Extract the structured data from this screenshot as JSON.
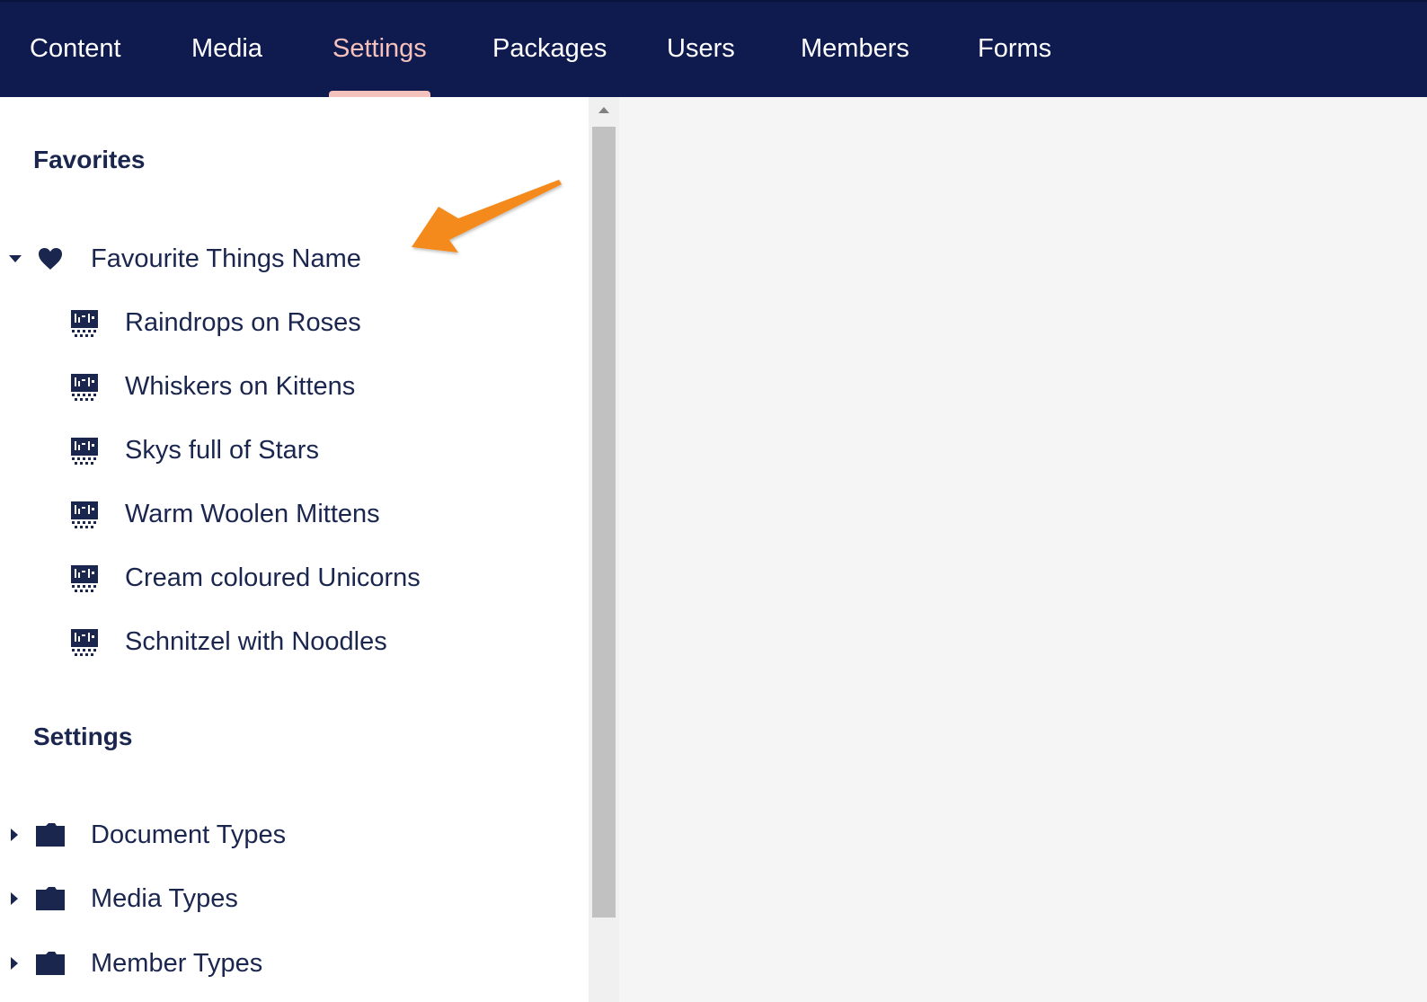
{
  "nav": {
    "items": [
      {
        "label": "Content",
        "active": false
      },
      {
        "label": "Media",
        "active": false
      },
      {
        "label": "Settings",
        "active": true
      },
      {
        "label": "Packages",
        "active": false
      },
      {
        "label": "Users",
        "active": false
      },
      {
        "label": "Members",
        "active": false
      },
      {
        "label": "Forms",
        "active": false
      }
    ]
  },
  "favorites": {
    "title": "Favorites",
    "group": {
      "label": "Favourite Things Name",
      "icon": "heart-icon",
      "expanded": true,
      "children": [
        {
          "label": "Raindrops on Roses",
          "icon": "document-type-icon"
        },
        {
          "label": "Whiskers on Kittens",
          "icon": "document-type-icon"
        },
        {
          "label": "Skys full of Stars",
          "icon": "document-type-icon"
        },
        {
          "label": "Warm Woolen Mittens",
          "icon": "document-type-icon"
        },
        {
          "label": "Cream coloured Unicorns",
          "icon": "document-type-icon"
        },
        {
          "label": "Schnitzel with Noodles",
          "icon": "document-type-icon"
        }
      ]
    }
  },
  "settings": {
    "title": "Settings",
    "items": [
      {
        "label": "Document Types",
        "icon": "folder-icon",
        "expanded": false
      },
      {
        "label": "Media Types",
        "icon": "folder-icon",
        "expanded": false
      },
      {
        "label": "Member Types",
        "icon": "folder-icon",
        "expanded": false
      }
    ]
  },
  "colors": {
    "topbar": "#0f1b4f",
    "active_nav": "#f5c1bc",
    "text": "#1b264f",
    "annotation_arrow": "#f58a1f"
  }
}
